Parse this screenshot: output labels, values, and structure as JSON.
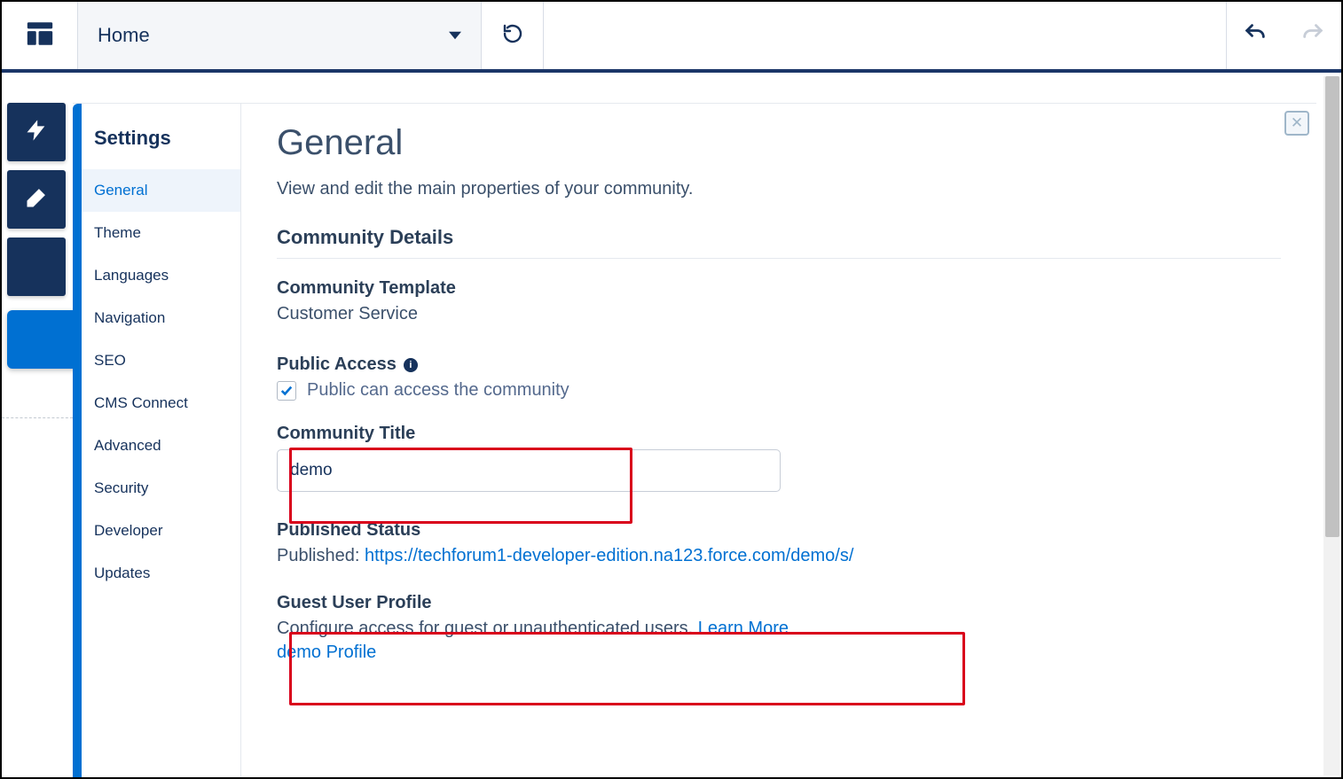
{
  "header": {
    "page_selector_label": "Home"
  },
  "sidebar": {
    "title": "Settings",
    "items": [
      {
        "label": "General"
      },
      {
        "label": "Theme"
      },
      {
        "label": "Languages"
      },
      {
        "label": "Navigation"
      },
      {
        "label": "SEO"
      },
      {
        "label": "CMS Connect"
      },
      {
        "label": "Advanced"
      },
      {
        "label": "Security"
      },
      {
        "label": "Developer"
      },
      {
        "label": "Updates"
      }
    ]
  },
  "main": {
    "heading": "General",
    "subtitle": "View and edit the main properties of your community.",
    "section_heading": "Community Details",
    "template_label": "Community Template",
    "template_value": "Customer Service",
    "public_access_label": "Public Access",
    "public_access_checkbox_label": "Public can access the community",
    "public_access_checked": true,
    "community_title_label": "Community Title",
    "community_title_value": "demo",
    "published_status_label": "Published Status",
    "published_prefix": "Published: ",
    "published_url": "https://techforum1-developer-edition.na123.force.com/demo/s/",
    "guest_profile_label": "Guest User Profile",
    "guest_profile_desc": "Configure access for guest or unauthenticated users. ",
    "learn_more": "Learn More",
    "guest_profile_link": "demo Profile"
  }
}
